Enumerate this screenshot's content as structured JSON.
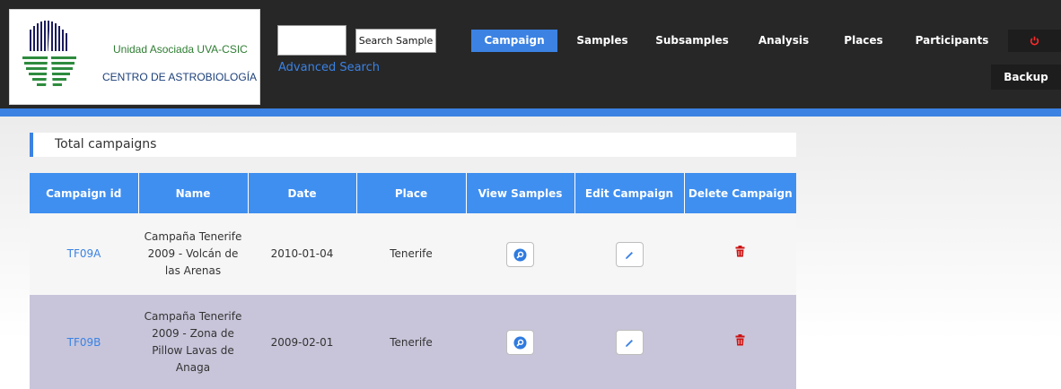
{
  "logo": {
    "line1": "Unidad Asociada UVA-CSIC",
    "line2": "CENTRO DE ASTROBIOLOGÍA"
  },
  "search": {
    "value": "",
    "button_label": "Search Sample",
    "advanced_label": "Advanced Search"
  },
  "nav": {
    "items": [
      {
        "label": "Campaign"
      },
      {
        "label": "Samples"
      },
      {
        "label": "Subsamples"
      },
      {
        "label": "Analysis"
      },
      {
        "label": "Places"
      },
      {
        "label": "Participants"
      }
    ],
    "logout_icon": "power-icon",
    "backup_label": "Backup"
  },
  "colors": {
    "header_bg": "#272727",
    "accent": "#3b82e3",
    "row_alt": "#c8c5da",
    "delete": "#cc1111"
  },
  "section": {
    "title": "Total campaigns"
  },
  "table": {
    "headers": [
      "Campaign id",
      "Name",
      "Date",
      "Place",
      "View Samples",
      "Edit Campaign",
      "Delete Campaign"
    ],
    "rows": [
      {
        "id": "TF09A",
        "name": "Campaña Tenerife 2009 - Volcán de las Arenas",
        "date": "2010-01-04",
        "place": "Tenerife",
        "view_icon": "search-icon",
        "edit_icon": "pencil-icon",
        "delete_icon": "trash-icon"
      },
      {
        "id": "TF09B",
        "name": "Campaña Tenerife 2009 - Zona de Pillow Lavas de Anaga",
        "date": "2009-02-01",
        "place": "Tenerife",
        "view_icon": "search-icon",
        "edit_icon": "pencil-icon",
        "delete_icon": "trash-icon"
      }
    ]
  }
}
